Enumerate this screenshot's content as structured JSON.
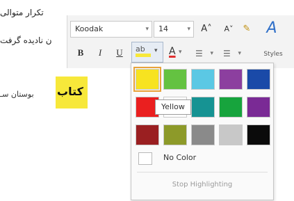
{
  "document": {
    "line1": "تکرار متوالی",
    "line2": "ن نادیده گرفت",
    "bold_word": "کتاب",
    "after_word": "بوستان سـ"
  },
  "toolbar": {
    "font_name": "Koodak",
    "font_size": "14",
    "dropdown_caret": "▾",
    "grow_font": "A˄",
    "shrink_font": "A˅",
    "clear_format": "✎",
    "styles_glyph": "A",
    "styles_label": "Styles",
    "bold": "B",
    "italic": "I",
    "underline": "U",
    "highlight_glyph": "ab",
    "highlight_color": "#f7e83a",
    "font_color_letter": "A",
    "bullets": "☰",
    "numbering": "☰"
  },
  "highlight_menu": {
    "colors": [
      [
        "#f7e320",
        "#64c241",
        "#5bc8e4",
        "#8c3f9f",
        "#1a4aa8"
      ],
      [
        "#ea1f1f",
        "#ffffff",
        "#169393",
        "#17a43d",
        "#7a2a95"
      ],
      [
        "#9a1f21",
        "#8d9a29",
        "#8a8a8a",
        "#c8c8c8",
        "#0b0b0b"
      ]
    ],
    "selected_color_name": "Yellow",
    "tooltip": "Yellow",
    "no_color_label": "No Color",
    "stop_label": "Stop Highlighting"
  }
}
